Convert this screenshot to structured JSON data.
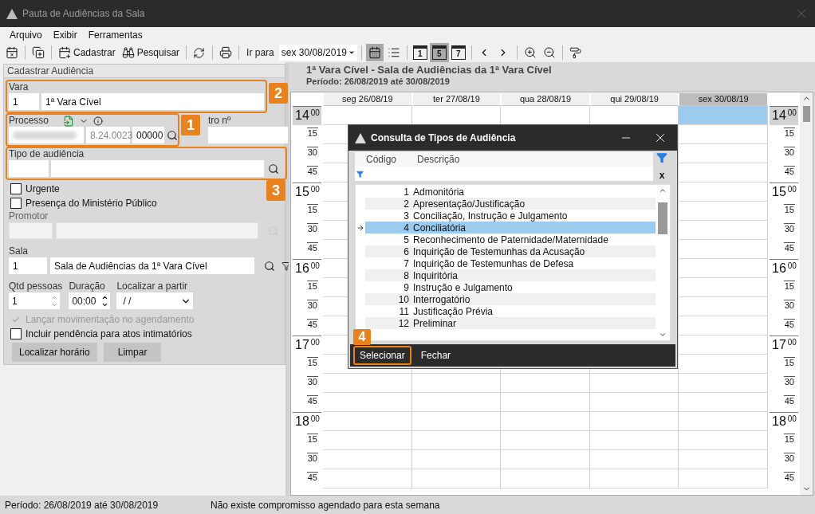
{
  "window": {
    "title": "Pauta de Audiências da Sala"
  },
  "menu": [
    "Arquivo",
    "Exibir",
    "Ferramentas"
  ],
  "toolbar": {
    "add_label": "Cadastrar",
    "search_label": "Pesquisar",
    "goto_label": "Ir para",
    "goto_date": "sex 30/08/2019",
    "view_buttons": [
      {
        "kind": "week",
        "selected": true
      },
      {
        "kind": "list",
        "selected": false
      }
    ],
    "range_buttons": [
      {
        "label": "1",
        "selected": false
      },
      {
        "label": "5",
        "selected": true
      },
      {
        "label": "7",
        "selected": false
      }
    ]
  },
  "form": {
    "title": "Cadastrar Audiência",
    "vara": {
      "label": "Vara",
      "code": "1",
      "name": "1ª Vara Cível",
      "callout": "2"
    },
    "processo": {
      "label": "Processo",
      "part_2": "8.24.0023",
      "part_3": "00000",
      "callout": "1"
    },
    "outro": {
      "label": "tro nº"
    },
    "tipo": {
      "label": "Tipo de audiência",
      "callout": "3"
    },
    "checks": [
      {
        "label": "Urgente",
        "checked": false
      },
      {
        "label": "Presença do Ministério Público",
        "checked": false
      }
    ],
    "promotor": {
      "label": "Promotor",
      "disabled": true
    },
    "sala": {
      "label": "Sala",
      "code": "1",
      "name": "Sala de Audiências da 1ª Vara Cível"
    },
    "qtd": {
      "label": "Qtd pessoas",
      "value": "1"
    },
    "duracao": {
      "label": "Duração",
      "value": "00:00"
    },
    "localizar": {
      "label": "Localizar a partir",
      "value": "/ /"
    },
    "options": [
      {
        "label": "Lançar movimentação no agendamento",
        "checked": true,
        "disabled": true
      },
      {
        "label": "Incluir pendência para atos intimatórios",
        "checked": false,
        "disabled": false
      }
    ],
    "buttons": [
      "Localizar horário",
      "Limpar"
    ]
  },
  "calendar": {
    "title": "1ª Vara Cível - Sala de Audiências da 1ª Vara Cível",
    "period": "Período: 26/08/2019 até 30/08/2019",
    "days": [
      {
        "label": "seg 26/08/19",
        "selected": false
      },
      {
        "label": "ter 27/08/19",
        "selected": false
      },
      {
        "label": "qua 28/08/19",
        "selected": false
      },
      {
        "label": "qui 29/08/19",
        "selected": false
      },
      {
        "label": "sex 30/08/19",
        "selected": true
      }
    ],
    "left_times": [
      {
        "hour": "14",
        "minute": "00",
        "selected": true
      },
      {
        "minute": "15",
        "selected": false
      },
      {
        "minute": "30",
        "selected": false
      },
      {
        "minute": "45",
        "selected": false
      },
      {
        "hour": "15",
        "minute": "00",
        "selected": false
      },
      {
        "minute": "15",
        "selected": false
      },
      {
        "minute": "30",
        "selected": false
      },
      {
        "minute": "45",
        "selected": false
      },
      {
        "hour": "16",
        "minute": "00",
        "selected": false
      },
      {
        "minute": "15",
        "selected": false
      },
      {
        "minute": "30",
        "selected": false
      },
      {
        "minute": "45",
        "selected": false
      },
      {
        "hour": "17",
        "minute": "00",
        "selected": false
      },
      {
        "minute": "15",
        "selected": false
      },
      {
        "minute": "30",
        "selected": false
      },
      {
        "minute": "45",
        "selected": false
      },
      {
        "hour": "18",
        "minute": "00",
        "selected": false
      },
      {
        "minute": "15",
        "selected": false
      },
      {
        "minute": "30",
        "selected": false
      },
      {
        "minute": "45",
        "selected": false
      }
    ],
    "right_times": [
      {
        "hour": "14",
        "minute": "00",
        "selected": true
      },
      {
        "minute": "15",
        "selected": false
      },
      {
        "minute": "30",
        "selected": false
      },
      {
        "minute": "45",
        "selected": false
      },
      {
        "hour": "15",
        "minute": "00",
        "selected": false
      },
      {
        "minute": "15",
        "selected": false
      },
      {
        "minute": "30",
        "selected": false
      },
      {
        "minute": "45",
        "selected": false
      },
      {
        "hour": "16",
        "minute": "00",
        "selected": false
      },
      {
        "minute": "15",
        "selected": false
      },
      {
        "minute": "30",
        "selected": false
      },
      {
        "minute": "45",
        "selected": false
      },
      {
        "hour": "17",
        "minute": "00",
        "selected": false
      },
      {
        "minute": "15",
        "selected": false
      },
      {
        "minute": "30",
        "selected": false
      },
      {
        "minute": "45",
        "selected": false
      },
      {
        "hour": "18",
        "minute": "00",
        "selected": false
      },
      {
        "minute": "15",
        "selected": false
      },
      {
        "minute": "30",
        "selected": false
      },
      {
        "minute": "45",
        "selected": false
      }
    ]
  },
  "dialog": {
    "title": "Consulta de Tipos de Audiência",
    "columns": [
      "Código",
      "Descrição"
    ],
    "rows": [
      {
        "code": "1",
        "description": "Admonitória",
        "selected": false
      },
      {
        "code": "2",
        "description": "Apresentação/Justificação",
        "selected": false
      },
      {
        "code": "3",
        "description": "Conciliação, Instrução e Julgamento",
        "selected": false
      },
      {
        "code": "4",
        "description": "Conciliatória",
        "selected": true
      },
      {
        "code": "5",
        "description": "Reconhecimento de Paternidade/Maternidade",
        "selected": false
      },
      {
        "code": "6",
        "description": "Inquirição de Testemunhas da Acusação",
        "selected": false
      },
      {
        "code": "7",
        "description": "Inquirição de Testemunhas de Defesa",
        "selected": false
      },
      {
        "code": "8",
        "description": "Inquiritória",
        "selected": false
      },
      {
        "code": "9",
        "description": "Instrução e Julgamento",
        "selected": false
      },
      {
        "code": "10",
        "description": "Interrogatório",
        "selected": false
      },
      {
        "code": "11",
        "description": "Justificação Prévia",
        "selected": false
      },
      {
        "code": "12",
        "description": "Preliminar",
        "selected": false
      }
    ],
    "filter_clear": "x",
    "buttons": [
      {
        "label": "Selecionar",
        "callout": "4"
      },
      {
        "label": "Fechar"
      }
    ]
  },
  "status_bar": [
    "Período: 26/08/2019 até 30/08/2019",
    "Não existe compromisso agendado para esta semana"
  ]
}
